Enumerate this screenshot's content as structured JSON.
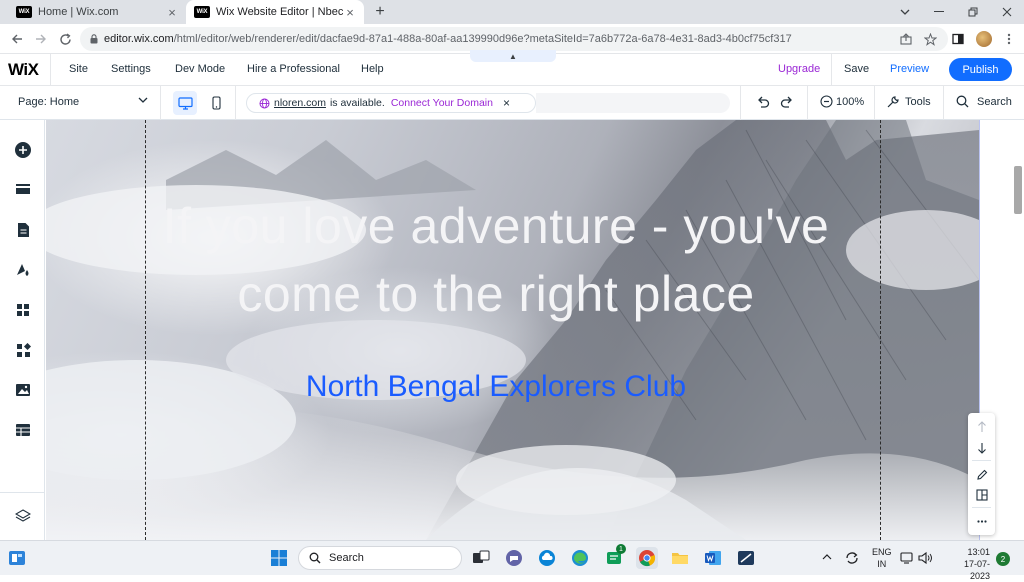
{
  "browser": {
    "tabs": [
      {
        "favicon": "WiX",
        "title": "Home | Wix.com",
        "active": false
      },
      {
        "favicon": "WiX",
        "title": "Wix Website Editor | Nbec",
        "active": true
      }
    ],
    "url": {
      "domain": "editor.wix.com",
      "path": "/html/editor/web/renderer/edit/dacfae9d-87a1-488a-80af-aa139990d96e?metaSiteId=7a6b772a-6a78-4e31-8ad3-4b0cf75cf317"
    }
  },
  "editor": {
    "logo": "WiX",
    "menu": [
      "Site",
      "Settings",
      "Dev Mode",
      "Hire a Professional",
      "Help"
    ],
    "upgrade_label": "Upgrade",
    "save_label": "Save",
    "preview_label": "Preview",
    "publish_label": "Publish",
    "page_selector": "Page: Home",
    "domain_banner": {
      "domain": "nloren.com",
      "status": "is available.",
      "cta": "Connect Your Domain"
    },
    "zoom_label": "100%",
    "tools_label": "Tools",
    "search_label": "Search"
  },
  "canvas": {
    "hero_title_line1": "If you love adventure - you've",
    "hero_title_line2": "come to the right place",
    "club_name": "North Bengal Explorers Club"
  },
  "taskbar": {
    "search_placeholder": "Search",
    "chat_badge": "1",
    "lang_primary": "ENG",
    "lang_secondary": "IN",
    "time": "13:01",
    "date": "17-07-2023",
    "notifications": "2"
  },
  "colors": {
    "wix_blue": "#116dff",
    "wix_purple": "#9a27d5",
    "club_text": "#1a5cff"
  }
}
